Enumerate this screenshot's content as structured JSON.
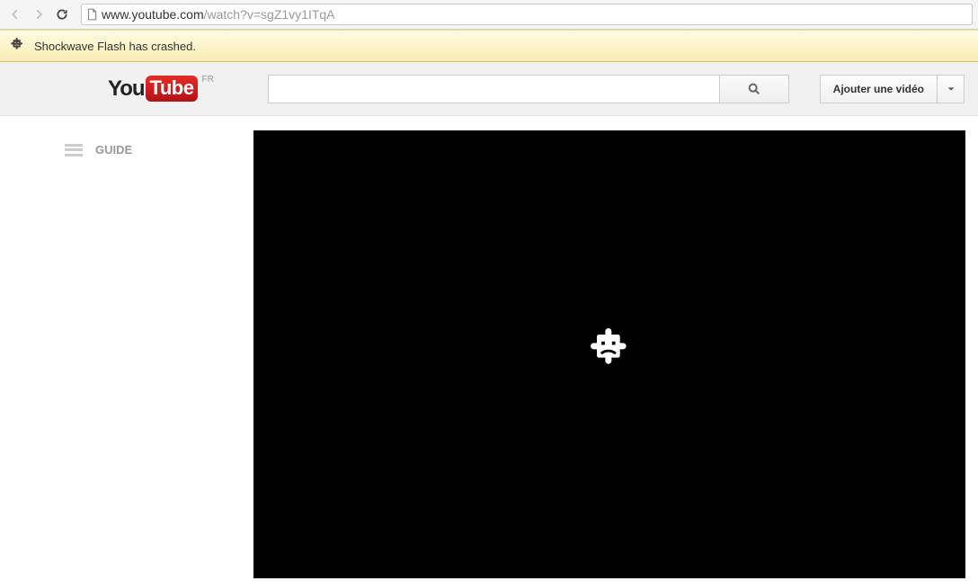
{
  "browser": {
    "url_domain": "www.youtube.com",
    "url_path": "/watch?v=sgZ1vy1ITqA"
  },
  "infobar": {
    "message": "Shockwave Flash has crashed."
  },
  "youtube": {
    "logo_you": "You",
    "logo_tube": "Tube",
    "region": "FR",
    "search_value": "",
    "upload_label": "Ajouter une vidéo",
    "guide_label": "GUIDE"
  }
}
